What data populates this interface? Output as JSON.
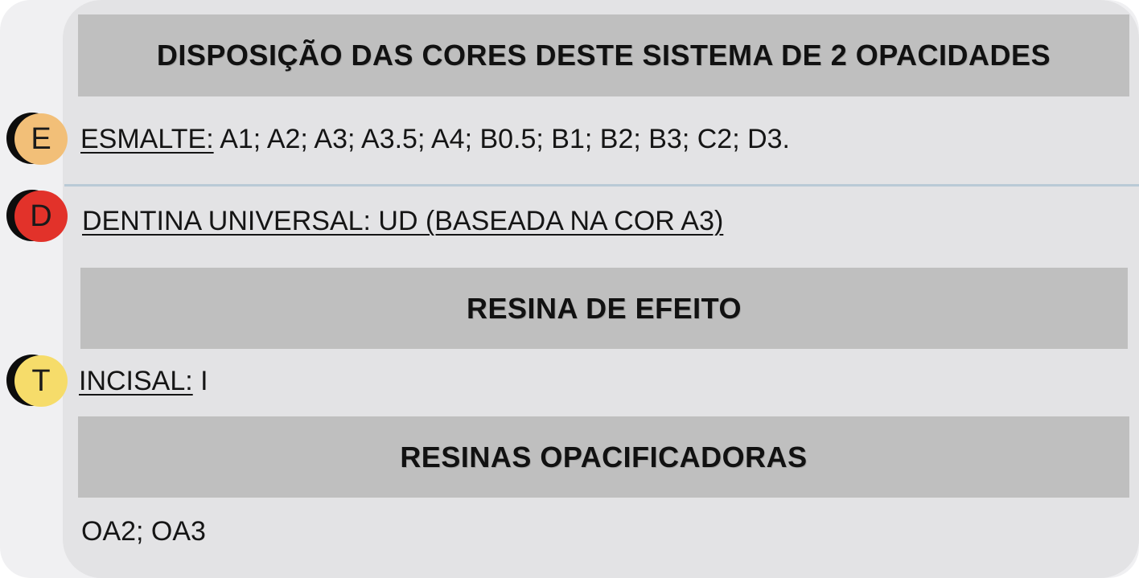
{
  "colors": {
    "enamel_badge": "#f2bf78",
    "dentin_badge": "#e2322a",
    "translucent_badge": "#f6dc6a",
    "section_bar": "#bfbfbf",
    "panel": "#e3e3e5"
  },
  "header": {
    "title": "DISPOSIÇÃO DAS CORES DESTE SISTEMA DE 2 OPACIDADES"
  },
  "esmalte": {
    "badge": "E",
    "label": "ESMALTE:",
    "value": " A1; A2; A3; A3.5; A4; B0.5; B1; B2; B3; C2; D3."
  },
  "dentina": {
    "badge": "D",
    "label": "DENTINA UNIVERSAL: UD (BASEADA NA COR A3)"
  },
  "efeito": {
    "title": "RESINA DE EFEITO",
    "badge": "T",
    "label": "INCISAL:",
    "value": " I"
  },
  "opacificadoras": {
    "title": "RESINAS OPACIFICADORAS",
    "value": "OA2; OA3"
  }
}
